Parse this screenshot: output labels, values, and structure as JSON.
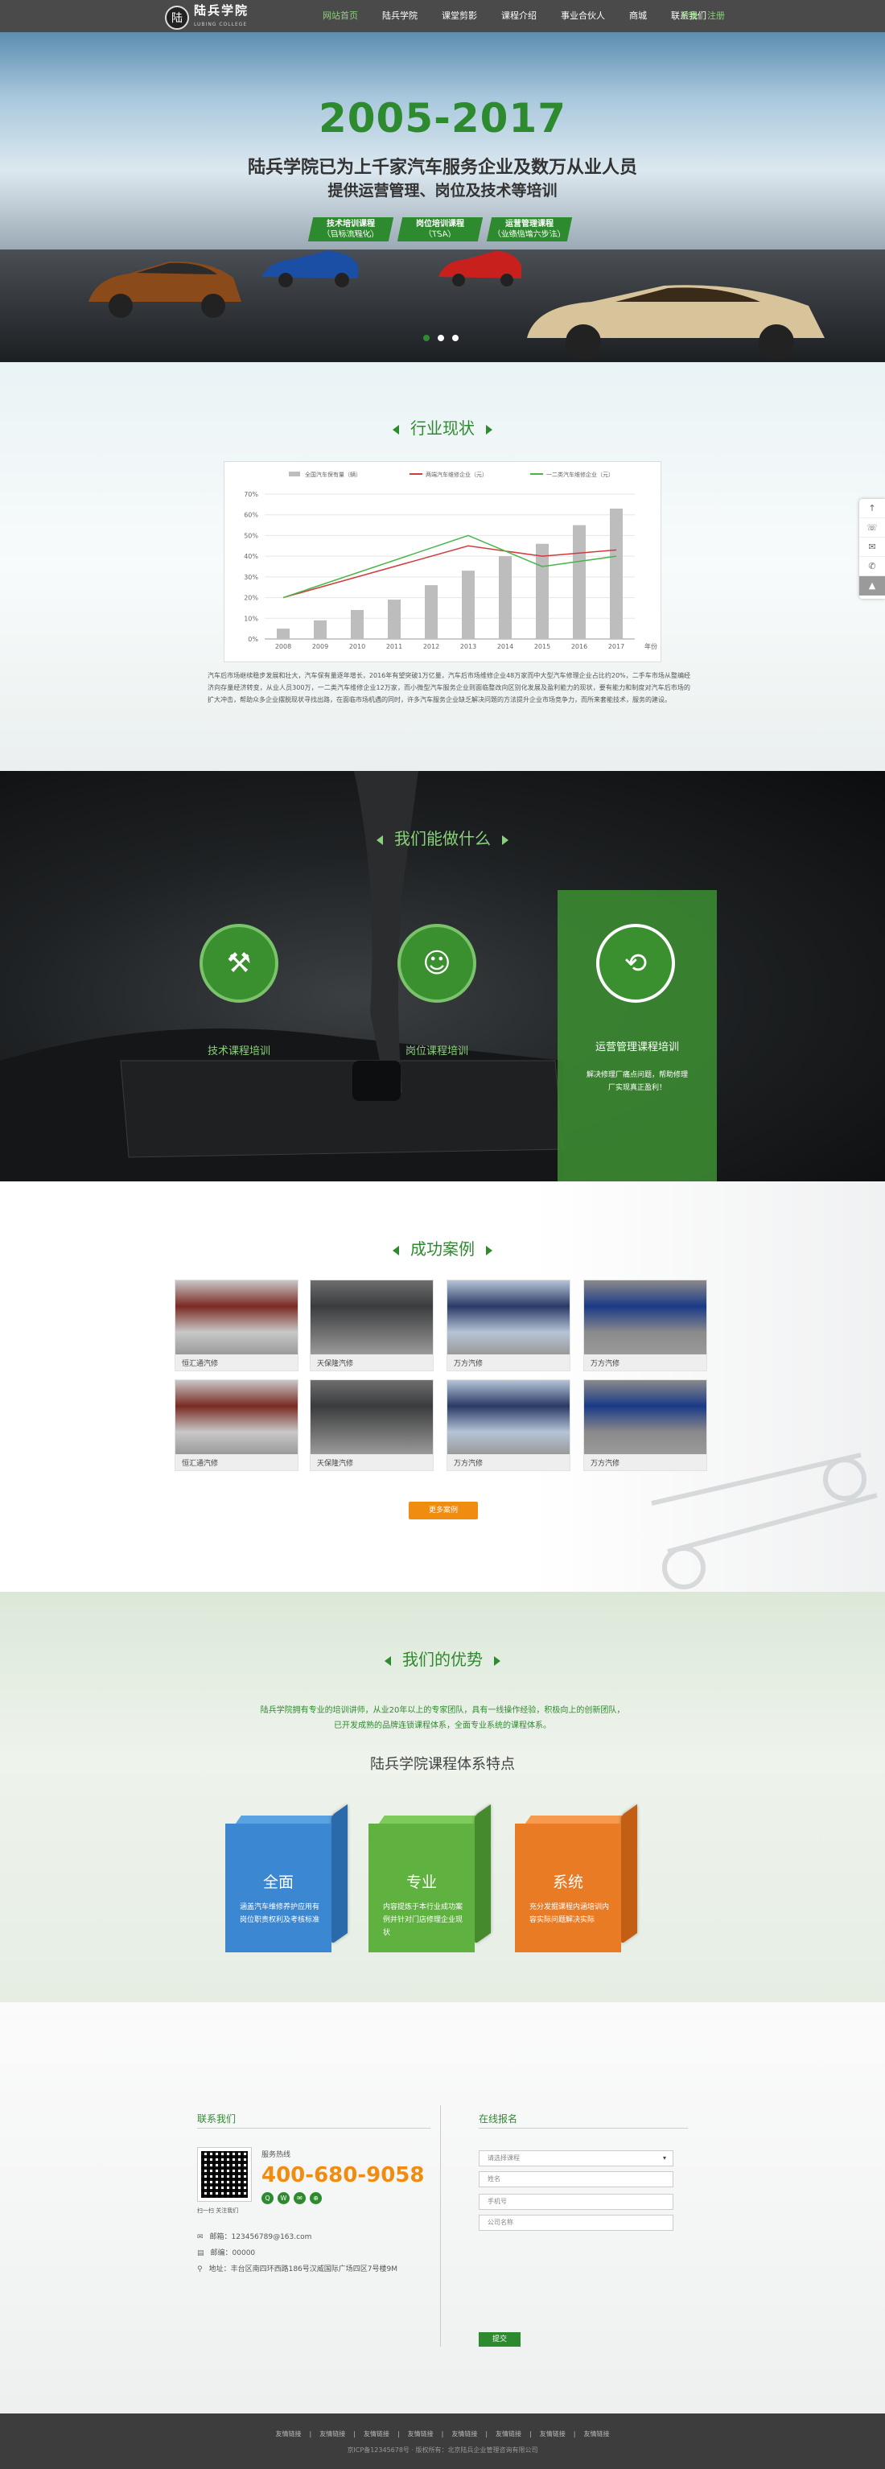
{
  "nav": {
    "logo_mark": "陆",
    "logo_name": "陆兵学院",
    "logo_sub": "LUBING COLLEGE",
    "items": [
      "网站首页",
      "陆兵学院",
      "课堂剪影",
      "课程介绍",
      "事业合伙人",
      "商城",
      "联系我们"
    ],
    "auth": "登录｜注册"
  },
  "hero": {
    "year": "2005-2017",
    "line1": "陆兵学院已为上千家汽车服务企业及数万从业人员",
    "line2": "提供运营管理、岗位及技术等培训",
    "tags": [
      {
        "l1": "技术培训课程",
        "l2": "（目标流程化）"
      },
      {
        "l1": "岗位培训课程",
        "l2": "（TSA）"
      },
      {
        "l1": "运营管理课程",
        "l2": "（业绩倍增六步法）"
      }
    ]
  },
  "industry": {
    "title": "行业现状",
    "text": "汽车后市场继续稳步发展和壮大，汽车保有量逐年增长，2016年有望突破1万亿量，汽车后市场维修企业48万家而中大型汽车修理企业占比约20%，二手车市场从整编经济向存量经济转变，从业人员300万，一二类汽车维修企业12万家，而小微型汽车服务企业则面临整改向区别化发展及盈利能力的现状，要有能力和制度对汽车后市场的扩大冲击，帮助众多企业摆脱现状寻找出路，在面临市场机遇的同时，许多汽车服务企业缺乏解决问题的方法提升企业市场竞争力，而所来套能技术，服务的建设。"
  },
  "chart_data": {
    "type": "bar",
    "categories": [
      "2008",
      "2009",
      "2010",
      "2011",
      "2012",
      "2013",
      "2014",
      "2015",
      "2016",
      "2017"
    ],
    "xlabel": "年份",
    "ylabel": "",
    "ylim": [
      0,
      70
    ],
    "yticks": [
      "0%",
      "10%",
      "20%",
      "30%",
      "40%",
      "50%",
      "60%",
      "70%"
    ],
    "grid": true,
    "legend_position": "top",
    "series": [
      {
        "name": "全国汽车保有量（辆）",
        "kind": "bar",
        "color": "#bdbdbd",
        "values": [
          5,
          9,
          14,
          19,
          26,
          33,
          40,
          46,
          55,
          63
        ]
      },
      {
        "name": "两端汽车维修企业（元）",
        "kind": "line",
        "color": "#d23b3b",
        "values": [
          20,
          null,
          null,
          null,
          null,
          45,
          null,
          40,
          null,
          43
        ]
      },
      {
        "name": "一二类汽车维修企业（元）",
        "kind": "line",
        "color": "#48b64a",
        "values": [
          20,
          null,
          null,
          null,
          null,
          50,
          null,
          35,
          null,
          40
        ]
      }
    ]
  },
  "what": {
    "title": "我们能做什么",
    "services": [
      {
        "label": "技术课程培训",
        "icon": "car-repair-icon"
      },
      {
        "label": "岗位课程培训",
        "icon": "person-icon"
      }
    ],
    "featured": {
      "label": "运营管理课程培训",
      "desc": "解决修理厂痛点问题，帮助修理厂实现真正盈利！",
      "icon": "network-icon"
    }
  },
  "cases": {
    "title": "成功案例",
    "items": [
      "恒汇通汽修",
      "天保隆汽修",
      "万方汽修",
      "万方汽修",
      "恒汇通汽修",
      "天保隆汽修",
      "万方汽修",
      "万方汽修"
    ],
    "more": "更多案例"
  },
  "adv": {
    "title": "我们的优势",
    "intro": "陆兵学院拥有专业的培训讲师，从业20年以上的专家团队，具有一线操作经验，积极向上的创新团队，已开发成熟的品牌连锁课程体系，全面专业系统的课程体系。",
    "heading": "陆兵学院课程体系特点",
    "cubes": [
      {
        "title": "全面",
        "desc": "涵盖汽车维修养护应用有岗位职责权利及考核标准",
        "color": "#3b87d1",
        "top": "#5aa3e3",
        "side": "#2a6aaa"
      },
      {
        "title": "专业",
        "desc": "内容提炼于本行业成功案例并针对门店修理企业现状",
        "color": "#5fb140",
        "top": "#7fca5c",
        "side": "#468a2e"
      },
      {
        "title": "系统",
        "desc": "充分发掘课程内涵培训内容实际问题解决实际",
        "color": "#ea7b25",
        "top": "#f59a4e",
        "side": "#c25f15"
      }
    ]
  },
  "contact": {
    "title": "联系我们",
    "hotline_label": "服务热线",
    "phone": "400-680-9058",
    "qr_caption": "扫一扫  关注我们",
    "email": "邮箱：123456789@163.com",
    "zip": "邮编：00000",
    "address": "地址：丰台区南四环西路186号汉威国际广场四区7号楼9M",
    "form_title": "在线报名",
    "select_placeholder": "请选择课程",
    "name_placeholder": "姓名",
    "phone_placeholder": "手机号",
    "company_placeholder": "公司名称",
    "submit": "提交"
  },
  "footer": {
    "links": [
      "友情链接",
      "友情链接",
      "友情链接",
      "友情链接",
      "友情链接",
      "友情链接",
      "友情链接",
      "友情链接"
    ],
    "copyright": "京ICP备12345678号 · 版权所有：北京陆兵企业管理咨询有限公司"
  },
  "side": [
    "↑",
    "☏",
    "✉",
    "✆",
    "…",
    "▲"
  ]
}
